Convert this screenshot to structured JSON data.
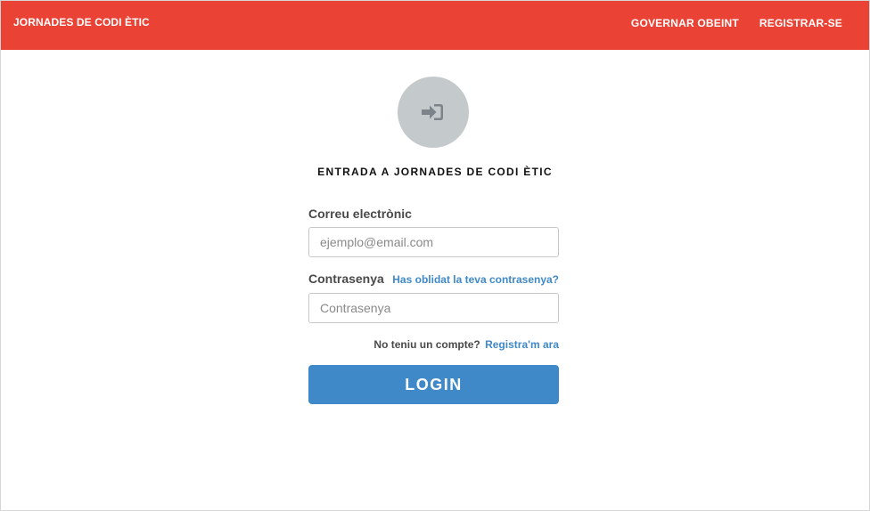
{
  "navbar": {
    "brand": "JORNADES DE CODI ÈTIC",
    "links": [
      "GOVERNAR OBEINT",
      "REGISTRAR-SE"
    ],
    "background_color": "#ea4235"
  },
  "login": {
    "icon": "sign-in-icon",
    "avatar_color": "#c4c9cc",
    "title": "ENTRADA A JORNADES DE CODI ÈTIC",
    "email": {
      "label": "Correu electrònic",
      "placeholder": "ejemplo@email.com",
      "value": ""
    },
    "password": {
      "label": "Contrasenya",
      "placeholder": "Contrasenya",
      "value": "",
      "forgot_link": "Has oblidat la teva contrasenya?"
    },
    "signup": {
      "text": "No teniu un compte?",
      "link": "Registra'm ara"
    },
    "submit_label": "LOGIN",
    "accent_color": "#3f89c9"
  }
}
